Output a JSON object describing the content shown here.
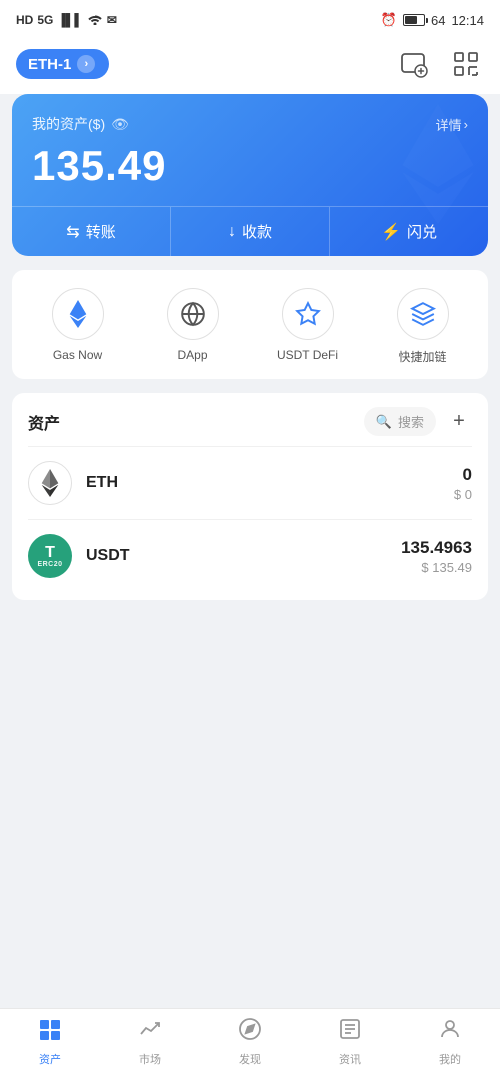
{
  "statusBar": {
    "network": "HD 5G",
    "battery": "64",
    "time": "12:14"
  },
  "header": {
    "walletName": "ETH-1",
    "cameraLabel": "camera",
    "scanLabel": "scan"
  },
  "assetCard": {
    "label": "我的资产($)",
    "detailText": "详情",
    "detailArrow": "›",
    "amount": "135.49",
    "actions": [
      {
        "icon": "⇆",
        "label": "转账"
      },
      {
        "icon": "↓",
        "label": "收款"
      },
      {
        "icon": "⚡",
        "label": "闪兑"
      }
    ]
  },
  "quickMenu": {
    "items": [
      {
        "id": "gas-now",
        "label": "Gas Now"
      },
      {
        "id": "dapp",
        "label": "DApp"
      },
      {
        "id": "usdt-defi",
        "label": "USDT DeFi"
      },
      {
        "id": "evm-chain",
        "label": "快捷加链"
      }
    ]
  },
  "assetsSection": {
    "title": "资产",
    "searchPlaceholder": "搜索",
    "assets": [
      {
        "id": "eth",
        "name": "ETH",
        "balance": "0",
        "usd": "$ 0"
      },
      {
        "id": "usdt",
        "name": "USDT",
        "balance": "135.4963",
        "usd": "$ 135.49"
      }
    ]
  },
  "bottomNav": {
    "items": [
      {
        "id": "assets",
        "label": "资产",
        "active": true
      },
      {
        "id": "market",
        "label": "市场",
        "active": false
      },
      {
        "id": "discover",
        "label": "发现",
        "active": false
      },
      {
        "id": "news",
        "label": "资讯",
        "active": false
      },
      {
        "id": "profile",
        "label": "我的",
        "active": false
      }
    ]
  }
}
